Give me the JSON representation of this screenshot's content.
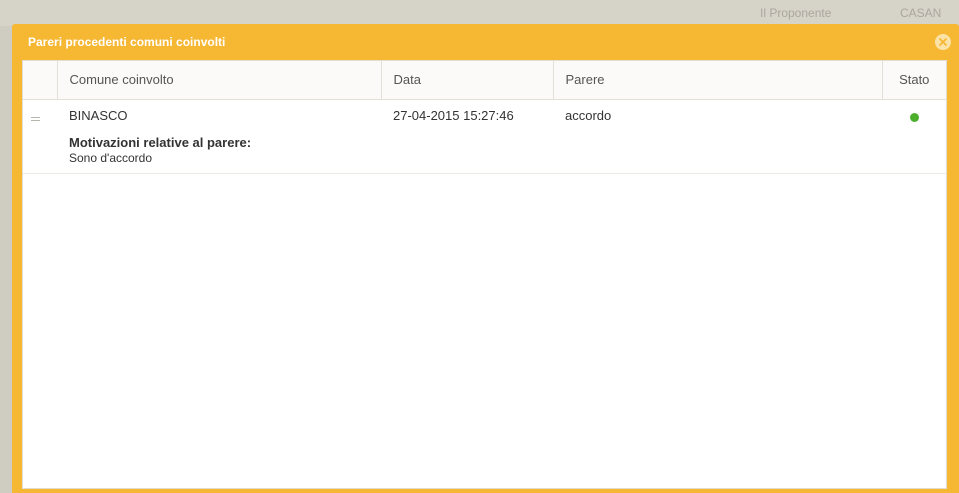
{
  "background": {
    "text_left": "Il Proponente",
    "text_right": "CASAN"
  },
  "window": {
    "title": "Pareri procedenti comuni coinvolti",
    "close_icon": "close-circle-icon",
    "accent_color": "#f6b733"
  },
  "table": {
    "headers": {
      "comune": "Comune coinvolto",
      "data": "Data",
      "parere": "Parere",
      "stato": "Stato"
    },
    "rows": [
      {
        "comune": "BINASCO",
        "data": "27-04-2015 15:27:46",
        "parere": "accordo",
        "stato_color": "#4caf2c",
        "detail_label": "Motivazioni relative al parere:",
        "detail_text": "Sono d'accordo"
      }
    ]
  }
}
